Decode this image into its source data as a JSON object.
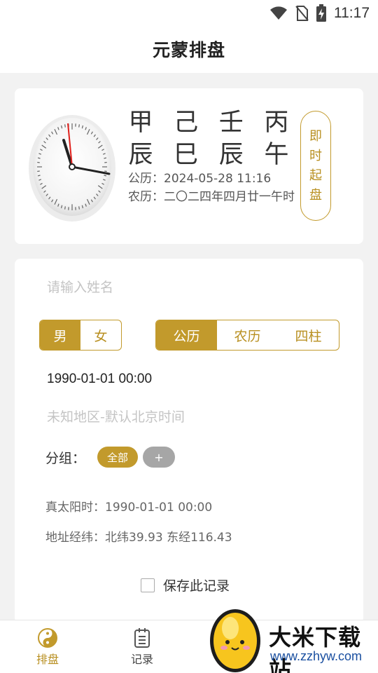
{
  "status_bar": {
    "time": "11:17",
    "icons": [
      "wifi-icon",
      "no-sim-icon",
      "battery-charging-icon"
    ]
  },
  "header": {
    "title": "元蒙排盘"
  },
  "info_card": {
    "ganzhi_top": [
      "甲",
      "己",
      "壬",
      "丙"
    ],
    "ganzhi_bottom": [
      "辰",
      "巳",
      "辰",
      "午"
    ],
    "solar": "公历：2024-05-28 11:16",
    "lunar": "农历：二〇二四年四月廿一午时",
    "instant_button": [
      "即",
      "时",
      "起",
      "盘"
    ]
  },
  "form": {
    "name_placeholder": "请输入姓名",
    "gender_options": [
      "男",
      "女"
    ],
    "gender_selected": "男",
    "calendar_options": [
      "公历",
      "农历",
      "四柱"
    ],
    "calendar_selected": "公历",
    "birth_datetime": "1990-01-01 00:00",
    "location_placeholder": "未知地区-默认北京时间",
    "group_label": "分组：",
    "group_tags": {
      "all": "全部",
      "add": "+"
    },
    "true_solar_time": "真太阳时：1990-01-01 00:00",
    "coordinates": "地址经纬：北纬39.93 东经116.43",
    "save_label": "保存此记录"
  },
  "bottom_nav": {
    "items": [
      {
        "label": "排盘",
        "icon": "yin-yang-icon",
        "active": true
      },
      {
        "label": "记录",
        "icon": "notepad-icon",
        "active": false
      }
    ]
  },
  "watermark": {
    "title": "大米下载站",
    "url": "www.zzhyw.com"
  },
  "colors": {
    "accent": "#c29a2c",
    "background": "#f2f2f2",
    "tag_gray": "#a6a6a6"
  }
}
